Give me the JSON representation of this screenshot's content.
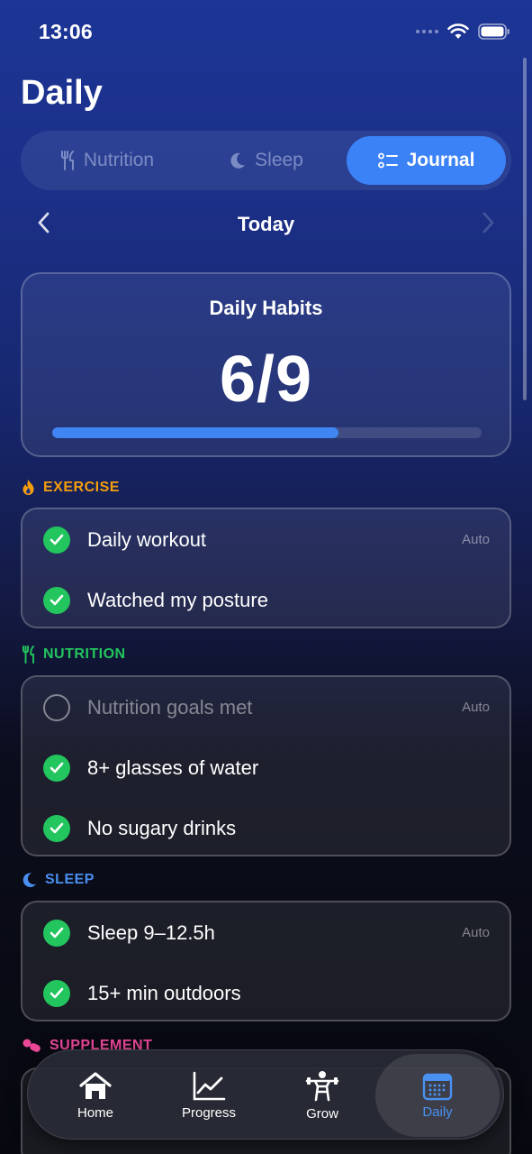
{
  "status": {
    "time": "13:06"
  },
  "header": {
    "title": "Daily"
  },
  "segments": [
    {
      "label": "Nutrition",
      "icon": "fork-knife-icon",
      "active": false
    },
    {
      "label": "Sleep",
      "icon": "moon-icon",
      "active": false
    },
    {
      "label": "Journal",
      "icon": "list-icon",
      "active": true
    }
  ],
  "date_nav": {
    "label": "Today"
  },
  "habits": {
    "title": "Daily Habits",
    "count": "6/9",
    "progress": 0.667
  },
  "sections": {
    "exercise": {
      "title": "EXERCISE",
      "color": "#f59e0b",
      "items": [
        {
          "label": "Daily workout",
          "done": true,
          "badge": "Auto"
        },
        {
          "label": "Watched my posture",
          "done": true
        }
      ]
    },
    "nutrition": {
      "title": "NUTRITION",
      "color": "#22c55e",
      "items": [
        {
          "label": "Nutrition goals met",
          "done": false,
          "badge": "Auto"
        },
        {
          "label": "8+ glasses of water",
          "done": true
        },
        {
          "label": "No sugary drinks",
          "done": true
        }
      ]
    },
    "sleep": {
      "title": "SLEEP",
      "color": "#4a8ff0",
      "items": [
        {
          "label": "Sleep 9–12.5h",
          "done": true,
          "badge": "Auto"
        },
        {
          "label": "15+ min outdoors",
          "done": true
        }
      ]
    },
    "supplement": {
      "title": "SUPPLEMENT",
      "color": "#ec4899"
    }
  },
  "tab_bar": [
    {
      "label": "Home",
      "icon": "house-icon"
    },
    {
      "label": "Progress",
      "icon": "chart-icon"
    },
    {
      "label": "Grow",
      "icon": "weightlifter-icon"
    },
    {
      "label": "Daily",
      "icon": "calendar-icon",
      "active": true
    }
  ]
}
